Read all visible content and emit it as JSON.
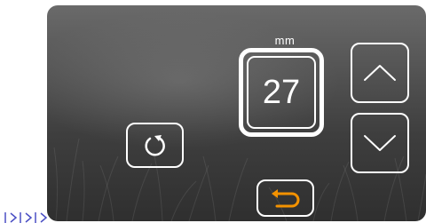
{
  "display": {
    "unit": "mm",
    "value": "27"
  },
  "controls": {
    "increment": {
      "icon": "chevron-up-icon"
    },
    "decrement": {
      "icon": "chevron-down-icon"
    },
    "reset": {
      "icon": "refresh-icon"
    },
    "back": {
      "icon": "undo-arrow-icon",
      "accent_color": "#f39200"
    }
  },
  "colors": {
    "line": "#ffffff",
    "accent": "#f39200",
    "fragment": "#4a4fc4"
  }
}
